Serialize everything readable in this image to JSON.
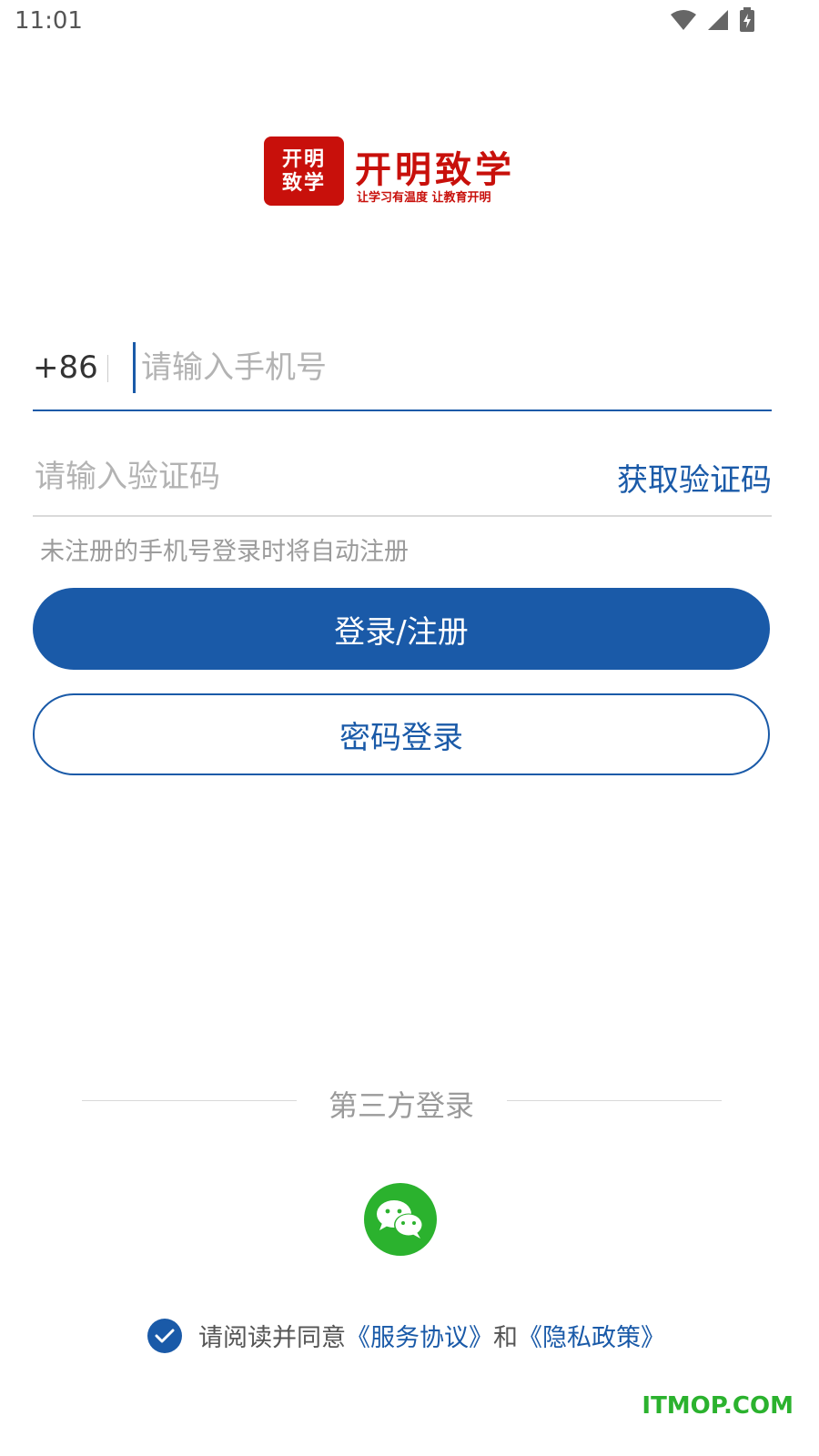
{
  "status_bar": {
    "time": "11:01",
    "icons": [
      "wifi-icon",
      "signal-icon",
      "battery-charging-icon"
    ]
  },
  "logo": {
    "box_line1": "开明",
    "box_line2": "致学",
    "title": "开明致学",
    "slogan": "让学习有温度 让教育开明"
  },
  "login_form": {
    "country_code": "+86",
    "phone_placeholder": "请输入手机号",
    "code_placeholder": "请输入验证码",
    "get_code_label": "获取验证码",
    "hint": "未注册的手机号登录时将自动注册",
    "login_button_label": "登录/注册",
    "password_login_label": "密码登录"
  },
  "third_party": {
    "title": "第三方登录",
    "providers": [
      "wechat-icon"
    ]
  },
  "agreement": {
    "checked": true,
    "prefix": "请阅读并同意",
    "service_link": "《服务协议》",
    "and": "和",
    "privacy_link": "《隐私政策》"
  },
  "watermark": "ITMOP.COM",
  "colors": {
    "primary": "#1a5aa8",
    "brand_red": "#c8100b",
    "wechat_green": "#2bb22e",
    "placeholder": "#b3b3b3"
  }
}
